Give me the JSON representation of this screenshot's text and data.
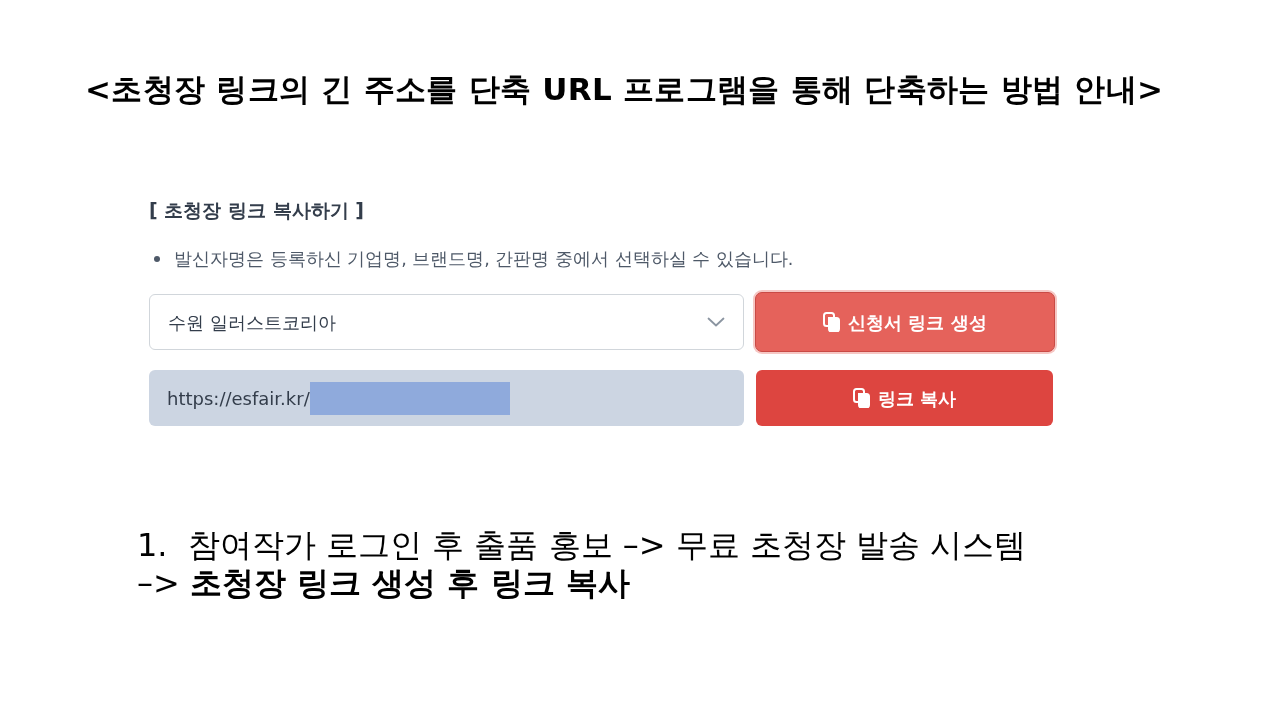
{
  "title": "<초청장 링크의 긴 주소를 단축 URL 프로그램을 통해 단축하는 방법 안내>",
  "panel": {
    "heading": "[ 초청장 링크 복사하기 ]",
    "notes": [
      "발신자명은 등록하신 기업명, 브랜드명, 간판명 중에서 선택하실 수 있습니다."
    ],
    "sender_select": {
      "value": "수원 일러스트코리아"
    },
    "create_button": {
      "label": "신청서 링크 생성",
      "focused": true
    },
    "link_field": {
      "value": "https://esfair.kr/",
      "redacted": true
    },
    "copy_button": {
      "label": "링크 복사"
    }
  },
  "steps": [
    {
      "text": "1.  참여작가 로그인 후 출품 홍보 –> 무료 초청장 발송 시스템\n–> **초청장 링크 생성 후 링크 복사**"
    }
  ]
}
